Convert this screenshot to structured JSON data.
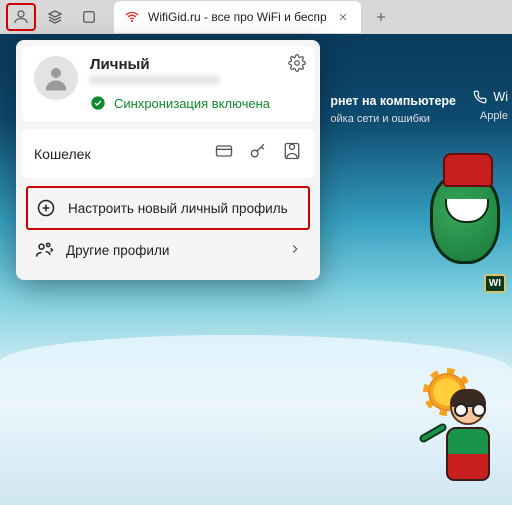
{
  "titlebar": {
    "tab_title": "WifiGid.ru - все про WiFi и беспр",
    "profile_btn": "profile",
    "collections_btn": "collections",
    "tab_overview_btn": "tab-overview"
  },
  "page": {
    "nav_col1_line1": "рнет на компьютере",
    "nav_col1_line2": "ойка сети и ошибки",
    "nav_col2_line1": "Wi",
    "nav_col2_line2": "Apple",
    "badge": "WI"
  },
  "popup": {
    "profile_name": "Личный",
    "sync_status": "Синхронизация включена",
    "wallet_label": "Кошелек",
    "add_profile_label": "Настроить новый личный профиль",
    "other_profiles_label": "Другие профили"
  }
}
